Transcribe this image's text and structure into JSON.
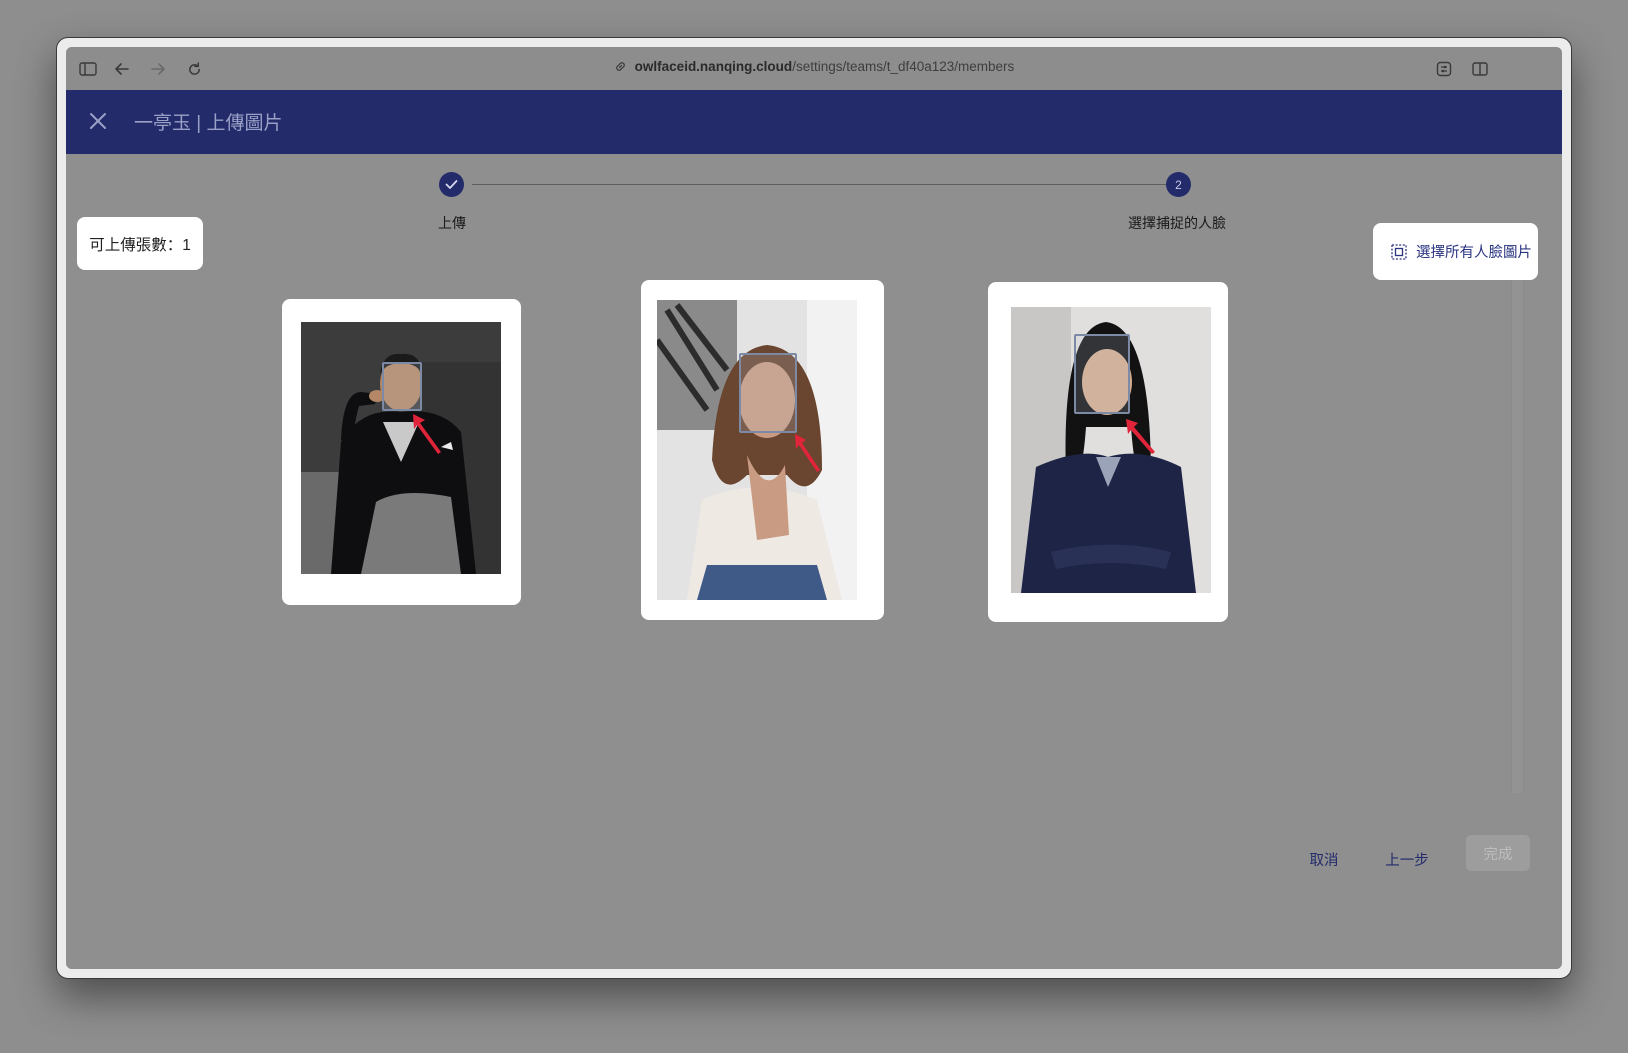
{
  "browser": {
    "url_host": "owlfaceid.nanqing.cloud",
    "url_path": "/settings/teams/t_df40a123/members"
  },
  "header": {
    "title": "一亭玉 | 上傳圖片"
  },
  "stepper": {
    "steps": [
      {
        "label": "上傳",
        "state": "done",
        "icon": "check-icon"
      },
      {
        "label": "選擇捕捉的人臉",
        "state": "active",
        "number": "2"
      }
    ]
  },
  "quota": {
    "text": "可上傳張數：1"
  },
  "actions": {
    "select_all_label": "選擇所有人臉圖片",
    "select_all_icon": "select-all-icon"
  },
  "photos": [
    {
      "subject": "man in dark blazer",
      "face_selected": true
    },
    {
      "subject": "woman with brown hair",
      "face_selected": true
    },
    {
      "subject": "woman in navy suit",
      "face_selected": true
    }
  ],
  "footer": {
    "cancel_label": "取消",
    "prev_label": "上一步",
    "done_label": "完成"
  },
  "colors": {
    "primary": "#232b6b",
    "overlay": "#8f8f8f",
    "arrow": "#e0243a"
  }
}
